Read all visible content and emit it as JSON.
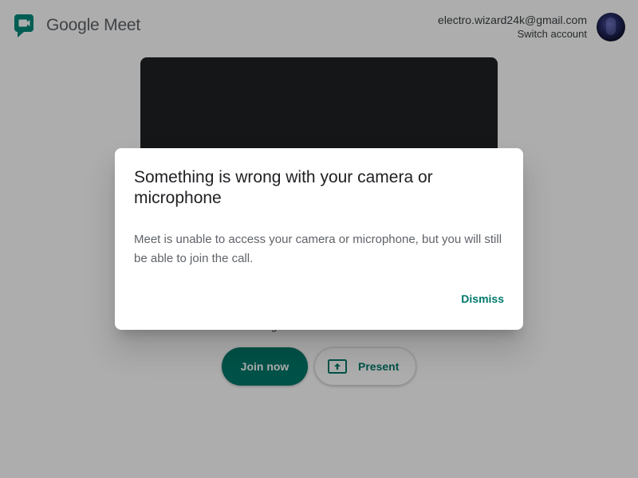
{
  "header": {
    "app_name": "Google Meet",
    "logo_icon": "google-meet-logo",
    "account_email": "electro.wizard24k@gmail.com",
    "switch_account_label": "Switch account",
    "avatar_icon": "user-avatar"
  },
  "preview": {
    "subtext": "g"
  },
  "actions": {
    "join_label": "Join now",
    "present_label": "Present",
    "present_icon": "present-screen-icon"
  },
  "dialog": {
    "title": "Something is wrong with your camera or microphone",
    "body": "Meet is unable to access your camera or microphone, but you will still be able to join the call.",
    "dismiss_label": "Dismiss"
  },
  "colors": {
    "accent": "#00796b",
    "video_background": "#202124",
    "scrim": "rgba(0,0,0,0.32)"
  }
}
